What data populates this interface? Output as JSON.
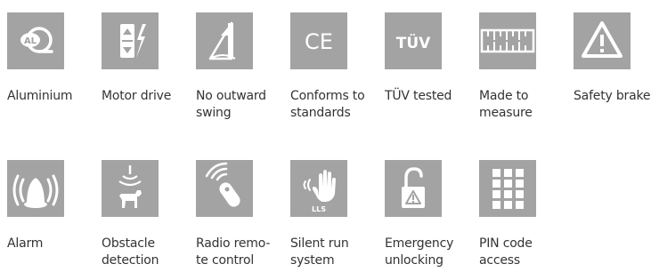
{
  "tile_color": "#a3a3a3",
  "icon_color": "#ffffff",
  "features": [
    {
      "icon": "aluminium-icon",
      "label": "Aluminium"
    },
    {
      "icon": "motor-drive-icon",
      "label": "Motor drive"
    },
    {
      "icon": "no-outward-swing-icon",
      "label": "No outward\nswing"
    },
    {
      "icon": "ce-mark-icon",
      "label": "Conforms to\nstandards"
    },
    {
      "icon": "tuv-icon",
      "label": "TÜV tested"
    },
    {
      "icon": "ruler-icon",
      "label": "Made to\nmeasure"
    },
    {
      "icon": "warning-triangle-icon",
      "label": "Safety brake"
    },
    {
      "icon": "alarm-icon",
      "label": "Alarm"
    },
    {
      "icon": "obstacle-detection-icon",
      "label": "Obstacle\ndetection"
    },
    {
      "icon": "radio-remote-icon",
      "label": "Radio remo-\nte control"
    },
    {
      "icon": "silent-run-icon",
      "label": "Silent run\nsystem"
    },
    {
      "icon": "emergency-unlock-icon",
      "label": "Emergency\nunlocking"
    },
    {
      "icon": "keypad-icon",
      "label": "PIN code\naccess"
    }
  ],
  "icon_text": {
    "aluminium": "AL",
    "ce": "CE",
    "tuv": "TÜV",
    "lls": "LLS"
  }
}
